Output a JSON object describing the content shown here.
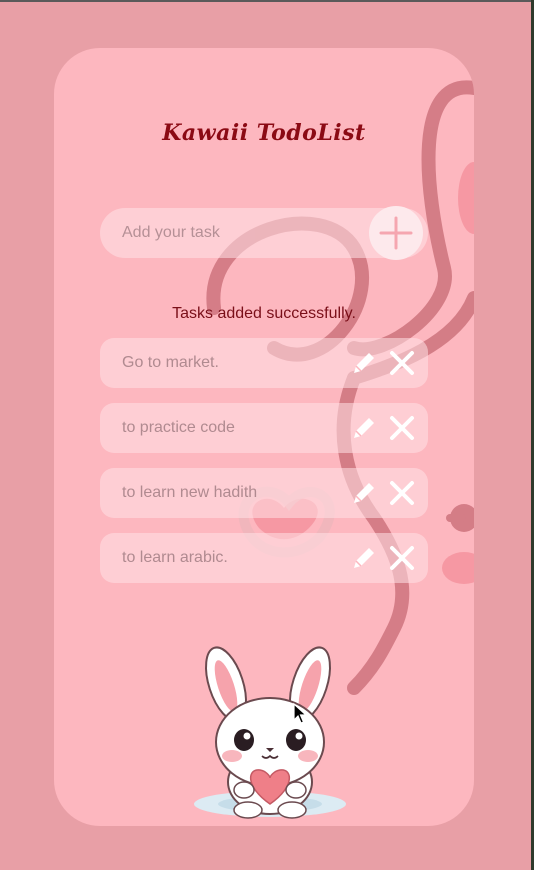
{
  "app": {
    "title": "Kawaii TodoList"
  },
  "task_input": {
    "value": "",
    "placeholder": "Add your task",
    "add_icon": "plus-icon"
  },
  "status_message": "Tasks added successfully.",
  "tasks": [
    {
      "text": "Go to market.",
      "edit_icon": "pencil-icon",
      "delete_icon": "close-icon"
    },
    {
      "text": "to practice code",
      "edit_icon": "pencil-icon",
      "delete_icon": "close-icon"
    },
    {
      "text": "to learn new hadith",
      "edit_icon": "pencil-icon",
      "delete_icon": "close-icon"
    },
    {
      "text": "to learn arabic.",
      "edit_icon": "pencil-icon",
      "delete_icon": "close-icon"
    }
  ],
  "colors": {
    "page_background": "#e89fa6",
    "card_background": "#fdb7bf",
    "title": "#8b0a14",
    "status": "#7a0f19",
    "icon": "#ffffff"
  }
}
